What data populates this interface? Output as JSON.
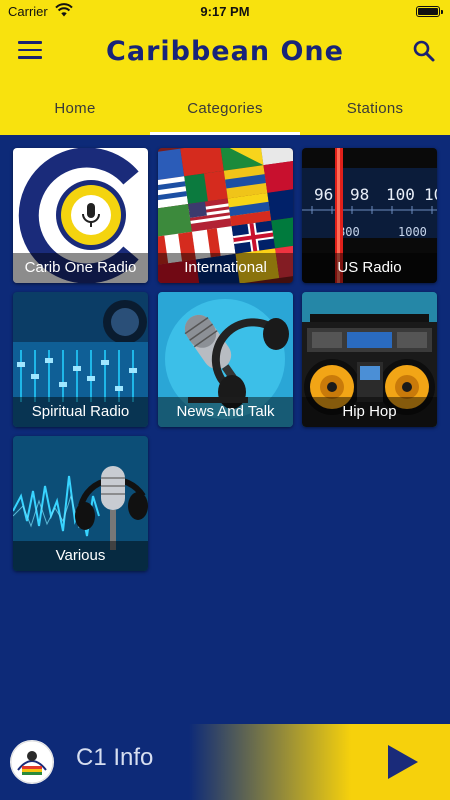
{
  "status_bar": {
    "carrier": "Carrier",
    "time": "9:17 PM"
  },
  "app_bar": {
    "title": "Caribbean One"
  },
  "tabs": [
    {
      "label": "Home",
      "active": false
    },
    {
      "label": "Categories",
      "active": true
    },
    {
      "label": "Stations",
      "active": false
    }
  ],
  "categories": [
    {
      "label": "Carib One Radio"
    },
    {
      "label": "International"
    },
    {
      "label": "US Radio"
    },
    {
      "label": "Spiritual Radio"
    },
    {
      "label": "News And Talk"
    },
    {
      "label": "Hip Hop"
    },
    {
      "label": "Various"
    }
  ],
  "player": {
    "title": "C1 Info"
  },
  "colors": {
    "brand_yellow": "#f8e20e",
    "brand_navy": "#0d2a78",
    "title_blue": "#182479"
  }
}
